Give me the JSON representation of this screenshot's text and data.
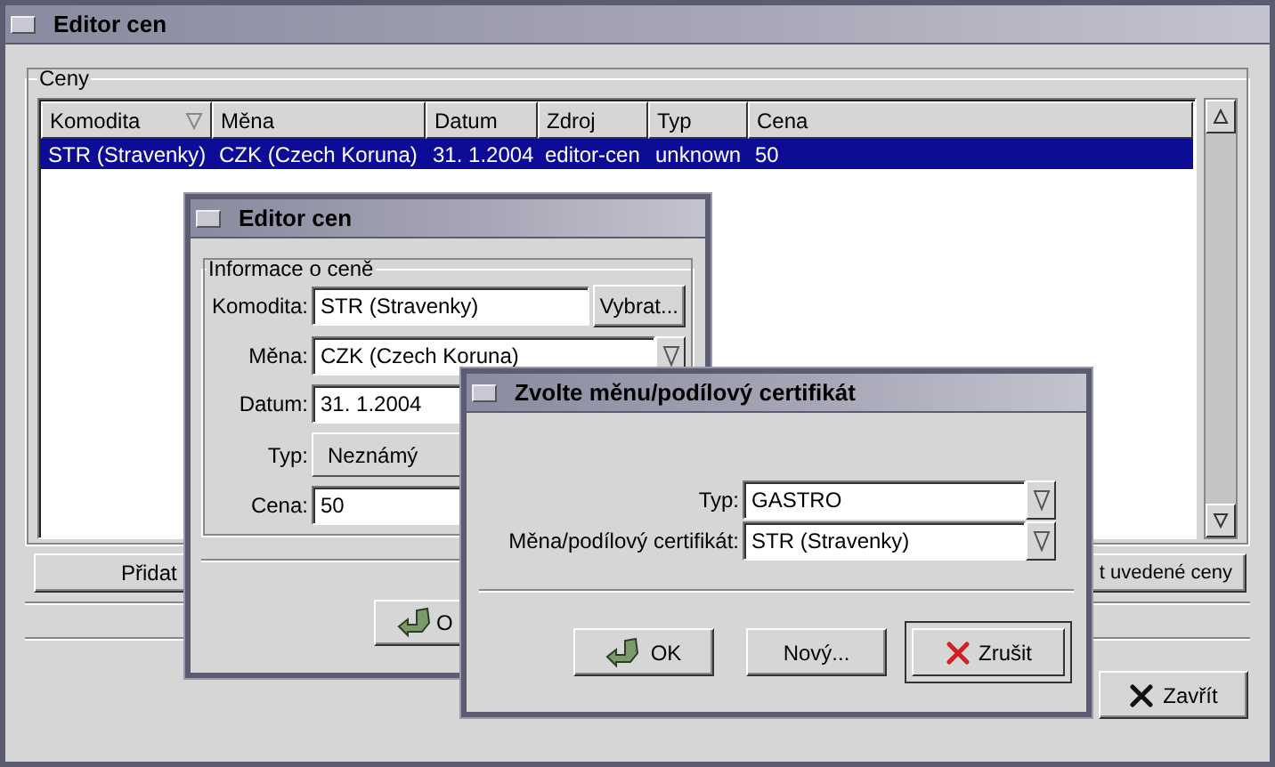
{
  "main_window": {
    "title": "Editor cen",
    "group_title": "Ceny",
    "table": {
      "columns": [
        {
          "label": "Komodita",
          "sorted": true
        },
        {
          "label": "Měna",
          "sorted": false
        },
        {
          "label": "Datum",
          "sorted": false
        },
        {
          "label": "Zdroj",
          "sorted": false
        },
        {
          "label": "Typ",
          "sorted": false
        },
        {
          "label": "Cena",
          "sorted": false
        }
      ],
      "rows": [
        {
          "cells": [
            "STR (Stravenky)",
            "CZK (Czech Koruna)",
            "31. 1.2004",
            "editor-cen",
            "unknown",
            "50"
          ],
          "selected": true
        }
      ]
    },
    "buttons": [
      "Přidat",
      "t uvedené ceny"
    ],
    "close_button": "Zavřít"
  },
  "price_dialog": {
    "title": "Editor cen",
    "group_title": "Informace o ceně",
    "fields": [
      {
        "label": "Komodita:",
        "value": "STR (Stravenky)",
        "kind": "text_button",
        "button": "Vybrat..."
      },
      {
        "label": "Měna:",
        "value": "CZK (Czech Koruna)",
        "kind": "combo"
      },
      {
        "label": "Datum:",
        "value": "31. 1.2004",
        "kind": "text"
      },
      {
        "label": "Typ:",
        "value": "Neznámý",
        "kind": "choice"
      },
      {
        "label": "Cena:",
        "value": "50",
        "kind": "text"
      }
    ],
    "ok_button": "O"
  },
  "choose_dialog": {
    "title": "Zvolte měnu/podílový certifikát",
    "fields": [
      {
        "label": "Typ:",
        "value": "GASTRO",
        "kind": "combo"
      },
      {
        "label": "Měna/podílový certifikát:",
        "value": "STR (Stravenky)",
        "kind": "combo"
      }
    ],
    "buttons": [
      {
        "label": "OK",
        "kind": "check",
        "default": false
      },
      {
        "label": "Nový...",
        "kind": "plain",
        "default": false
      },
      {
        "label": "Zrušit",
        "kind": "cross",
        "default": true
      }
    ]
  }
}
